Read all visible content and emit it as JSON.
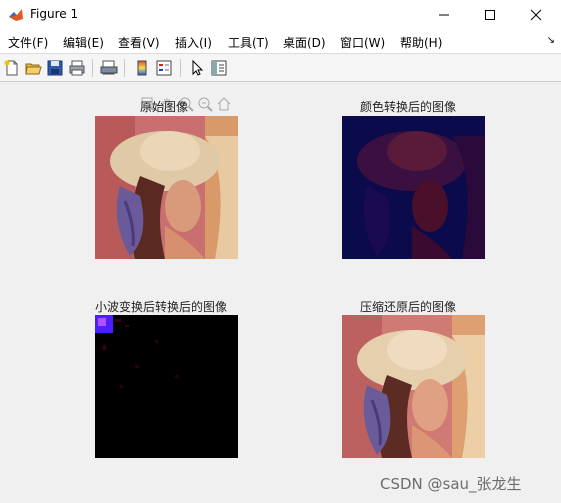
{
  "window": {
    "title": "Figure 1"
  },
  "menu": {
    "items": [
      {
        "label": "文件(F)"
      },
      {
        "label": "编辑(E)"
      },
      {
        "label": "查看(V)"
      },
      {
        "label": "插入(I)"
      },
      {
        "label": "工具(T)"
      },
      {
        "label": "桌面(D)"
      },
      {
        "label": "窗口(W)"
      },
      {
        "label": "帮助(H)"
      }
    ]
  },
  "toolbar": {
    "buttons": [
      {
        "icon": "new-figure-icon"
      },
      {
        "icon": "open-file-icon"
      },
      {
        "icon": "save-icon"
      },
      {
        "icon": "print-icon"
      },
      {
        "icon": "print-preview-icon"
      },
      {
        "icon": "colorbar-icon"
      },
      {
        "icon": "legend-icon"
      },
      {
        "icon": "edit-plot-arrow-icon"
      },
      {
        "icon": "property-inspector-icon"
      }
    ]
  },
  "axes_tools": [
    "brush-icon",
    "pan-hand-icon",
    "zoom-in-icon",
    "zoom-out-icon",
    "home-icon"
  ],
  "plots": [
    {
      "title": "原始图像",
      "colors": {
        "sky": "#c96f6f",
        "hat": "#e0c9a6",
        "feather": "#6b5a9a",
        "skin": "#d99a7c",
        "hair": "#5a2a22"
      }
    },
    {
      "title": "颜色转换后的图像",
      "colors": {
        "bg": "#0b0a4a",
        "dark": "#2a0a3a",
        "red": "#7a1a2a"
      }
    },
    {
      "title": "小波变换后转换后的图像",
      "colors": {
        "bg": "#000000",
        "patch": "#4a20ff",
        "noise": "#3a0010"
      }
    },
    {
      "title": "压缩还原后的图像",
      "colors": {
        "sky": "#cf7a72",
        "hat": "#e6cfad",
        "feather": "#6a5c98",
        "skin": "#e0a084",
        "hair": "#5c2c24"
      }
    }
  ],
  "watermark": "CSDN @sau_张龙生"
}
